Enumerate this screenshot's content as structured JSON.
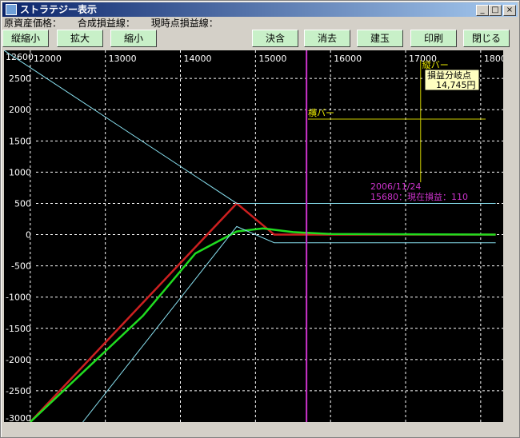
{
  "window": {
    "title": "ストラテジー表示",
    "buttons": {
      "minimize": "_",
      "maximize": "□",
      "close": "×"
    }
  },
  "info": {
    "underlying_price": "原資産価格：",
    "combined_line": "合成損益線：",
    "current_line": "現時点損益線："
  },
  "toolbar": {
    "zoom_v": "縦縮小",
    "enlarge": "拡大",
    "shrink": "縮小",
    "confirm": "決含",
    "erase": "消去",
    "build": "建玉",
    "print": "印刷",
    "close": "閉じる"
  },
  "chart_data": {
    "type": "line",
    "x_ticks": [
      12000,
      13000,
      14000,
      15000,
      16000,
      17000,
      18000
    ],
    "x_tick_labels": [
      "12000",
      "13000",
      "14000",
      "15000",
      "16000",
      "17000",
      "18000"
    ],
    "y_ticks": [
      2500,
      2000,
      1500,
      1000,
      500,
      0,
      -500,
      -1000,
      -1500,
      -2000,
      -2500
    ],
    "y_tick_labels": [
      "2500",
      "2000",
      "1500",
      "1000",
      "500",
      "0",
      "-500",
      "-1000",
      "-1500",
      "-2000",
      "-2500",
      "-3000"
    ],
    "xlim": [
      11650,
      18300
    ],
    "ylim": [
      -3000,
      2950
    ],
    "grid": true,
    "series": [
      {
        "color": "#cc2020",
        "x": [
          12000,
          14750,
          15250,
          18200
        ],
        "y": [
          -3000,
          500,
          0,
          0
        ]
      },
      {
        "color": "#20dd20",
        "x": [
          12000,
          13500,
          14200,
          14750,
          15100,
          15500,
          16000,
          18200
        ],
        "y": [
          -3000,
          -1300,
          -300,
          50,
          100,
          40,
          10,
          0
        ]
      },
      {
        "color": "#88e0f0",
        "x": [
          11650,
          14750,
          18200
        ],
        "y": [
          2950,
          500,
          500
        ]
      },
      {
        "color": "#88e0f0",
        "x": [
          12700,
          14750,
          15250,
          18200
        ],
        "y": [
          -3000,
          130,
          -130,
          -130
        ]
      }
    ],
    "vertical_bar": {
      "x": 15680,
      "label": "2006/11/24",
      "value_label": "15680：現在損益：110",
      "color": "#cc33cc"
    },
    "cursor": {
      "vertical_label": "縦バー",
      "horizontal_label": "横バー",
      "x": 17200,
      "y": 1850,
      "breakeven_label": "損益分岐点",
      "breakeven_value": "14,745円"
    },
    "top_left_partial": "12600"
  }
}
